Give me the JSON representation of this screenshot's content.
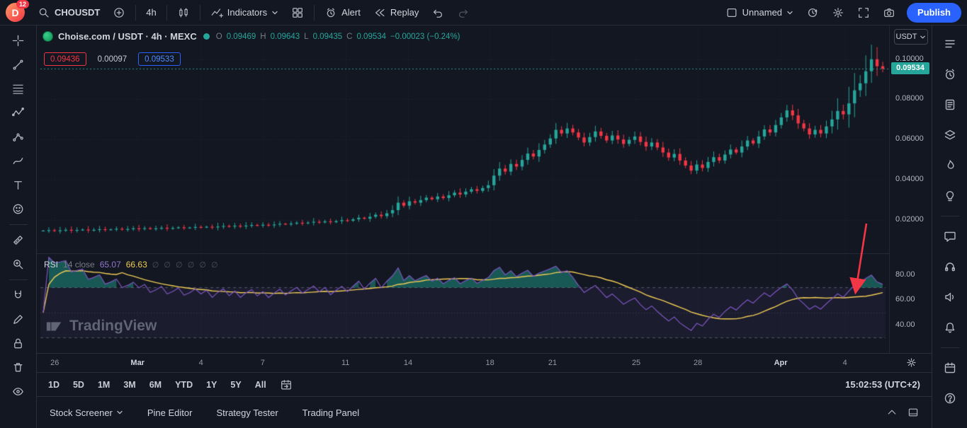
{
  "topbar": {
    "avatar_initial": "D",
    "notifications": "12",
    "symbol": "CHOUSDT",
    "interval": "4h",
    "indicators": "Indicators",
    "alert": "Alert",
    "replay": "Replay",
    "layout_name": "Unnamed",
    "publish": "Publish"
  },
  "legend": {
    "title": "Choise.com / USDT · 4h · MEXC",
    "open_label": "O",
    "open": "0.09469",
    "high_label": "H",
    "high": "0.09643",
    "low_label": "L",
    "low": "0.09435",
    "close_label": "C",
    "close": "0.09534",
    "change": "−0.00023 (−0.24%)"
  },
  "price_tools": {
    "sell": "0.09436",
    "quantity": "0.00097",
    "buy": "0.09533"
  },
  "rsi": {
    "name": "RSI",
    "params": "14 close",
    "value": "65.07",
    "ma_value": "66.63",
    "hidden_values": "∅ ∅ ∅ ∅ ∅ ∅"
  },
  "watermark": "TradingView",
  "price_scale": {
    "currency": "USDT",
    "ticks": [
      "0.10000",
      "0.08000",
      "0.06000",
      "0.04000",
      "0.02000"
    ],
    "tick_values": [
      0.1,
      0.08,
      0.06,
      0.04,
      0.02
    ],
    "last_price": "0.09534",
    "rsi_ticks": [
      "80.00",
      "60.00",
      "40.00"
    ],
    "rsi_tick_values": [
      80,
      60,
      40
    ]
  },
  "time_axis": {
    "ticks": [
      {
        "label": "26",
        "pos": 0.017,
        "major": false
      },
      {
        "label": "Mar",
        "pos": 0.115,
        "major": true
      },
      {
        "label": "4",
        "pos": 0.19,
        "major": false
      },
      {
        "label": "7",
        "pos": 0.263,
        "major": false
      },
      {
        "label": "11",
        "pos": 0.361,
        "major": false
      },
      {
        "label": "14",
        "pos": 0.435,
        "major": false
      },
      {
        "label": "18",
        "pos": 0.532,
        "major": false
      },
      {
        "label": "21",
        "pos": 0.606,
        "major": false
      },
      {
        "label": "25",
        "pos": 0.705,
        "major": false
      },
      {
        "label": "28",
        "pos": 0.778,
        "major": false
      },
      {
        "label": "Apr",
        "pos": 0.876,
        "major": true
      },
      {
        "label": "4",
        "pos": 0.952,
        "major": false
      }
    ]
  },
  "range_bar": {
    "ranges": [
      "1D",
      "5D",
      "1M",
      "3M",
      "6M",
      "YTD",
      "1Y",
      "5Y",
      "All"
    ],
    "clock": "15:02:53 (UTC+2)"
  },
  "bottom_tabs": {
    "tabs": [
      "Stock Screener",
      "Pine Editor",
      "Strategy Tester",
      "Trading Panel"
    ]
  },
  "colors": {
    "up": "#26a69a",
    "down": "#f23645",
    "accent": "#2962ff",
    "rsi_line": "#7e57c2",
    "rsi_ma": "#f0cc55",
    "arrow": "#f23645",
    "last_price_bg": "#26a69a"
  },
  "chart_data": {
    "type": "candlestick",
    "title": "Choise.com / USDT",
    "exchange": "MEXC",
    "interval": "4h",
    "price_range": [
      0.004,
      0.114
    ],
    "grid_prices": [
      0.02,
      0.04,
      0.06,
      0.08,
      0.1
    ],
    "last_price": 0.09534,
    "closes": [
      0.0146,
      0.0148,
      0.0145,
      0.0147,
      0.015,
      0.0147,
      0.0149,
      0.0151,
      0.0148,
      0.015,
      0.0153,
      0.015,
      0.0152,
      0.0155,
      0.0152,
      0.0154,
      0.0157,
      0.0155,
      0.0158,
      0.0155,
      0.0157,
      0.016,
      0.0157,
      0.0159,
      0.0162,
      0.0159,
      0.0161,
      0.0164,
      0.0162,
      0.0165,
      0.0162,
      0.0166,
      0.0169,
      0.0166,
      0.017,
      0.0167,
      0.0171,
      0.0174,
      0.0171,
      0.0175,
      0.0172,
      0.0176,
      0.018,
      0.0177,
      0.0181,
      0.0185,
      0.0182,
      0.0186,
      0.019,
      0.0187,
      0.0192,
      0.0188,
      0.0193,
      0.0198,
      0.0195,
      0.0202,
      0.021,
      0.0205,
      0.0215,
      0.0225,
      0.0218,
      0.0232,
      0.0248,
      0.0285,
      0.027,
      0.0292,
      0.0285,
      0.0298,
      0.031,
      0.0302,
      0.0316,
      0.0308,
      0.0322,
      0.0335,
      0.0326,
      0.034,
      0.0352,
      0.0344,
      0.0358,
      0.0372,
      0.042,
      0.0455,
      0.044,
      0.0478,
      0.0465,
      0.0498,
      0.053,
      0.0515,
      0.0548,
      0.0575,
      0.0605,
      0.0648,
      0.063,
      0.0655,
      0.0635,
      0.061,
      0.0585,
      0.0612,
      0.064,
      0.0618,
      0.0595,
      0.062,
      0.06,
      0.0578,
      0.0598,
      0.0615,
      0.0588,
      0.0565,
      0.0585,
      0.056,
      0.0535,
      0.051,
      0.0528,
      0.0495,
      0.047,
      0.0445,
      0.0475,
      0.0458,
      0.0488,
      0.0512,
      0.0495,
      0.0525,
      0.055,
      0.0535,
      0.0565,
      0.0595,
      0.058,
      0.0615,
      0.065,
      0.0635,
      0.0672,
      0.071,
      0.0745,
      0.072,
      0.068,
      0.0655,
      0.0625,
      0.0648,
      0.063,
      0.0665,
      0.07,
      0.0742,
      0.0725,
      0.078,
      0.0845,
      0.088,
      0.094,
      0.1,
      0.0965,
      0.0953
    ],
    "indicator": {
      "type": "RSI",
      "length": 14,
      "source": "close",
      "value": 65.07,
      "ma_value": 66.63,
      "range": [
        28,
        95
      ],
      "levels": [
        70,
        50,
        30
      ],
      "grid_values": [
        80,
        60,
        40
      ]
    }
  }
}
